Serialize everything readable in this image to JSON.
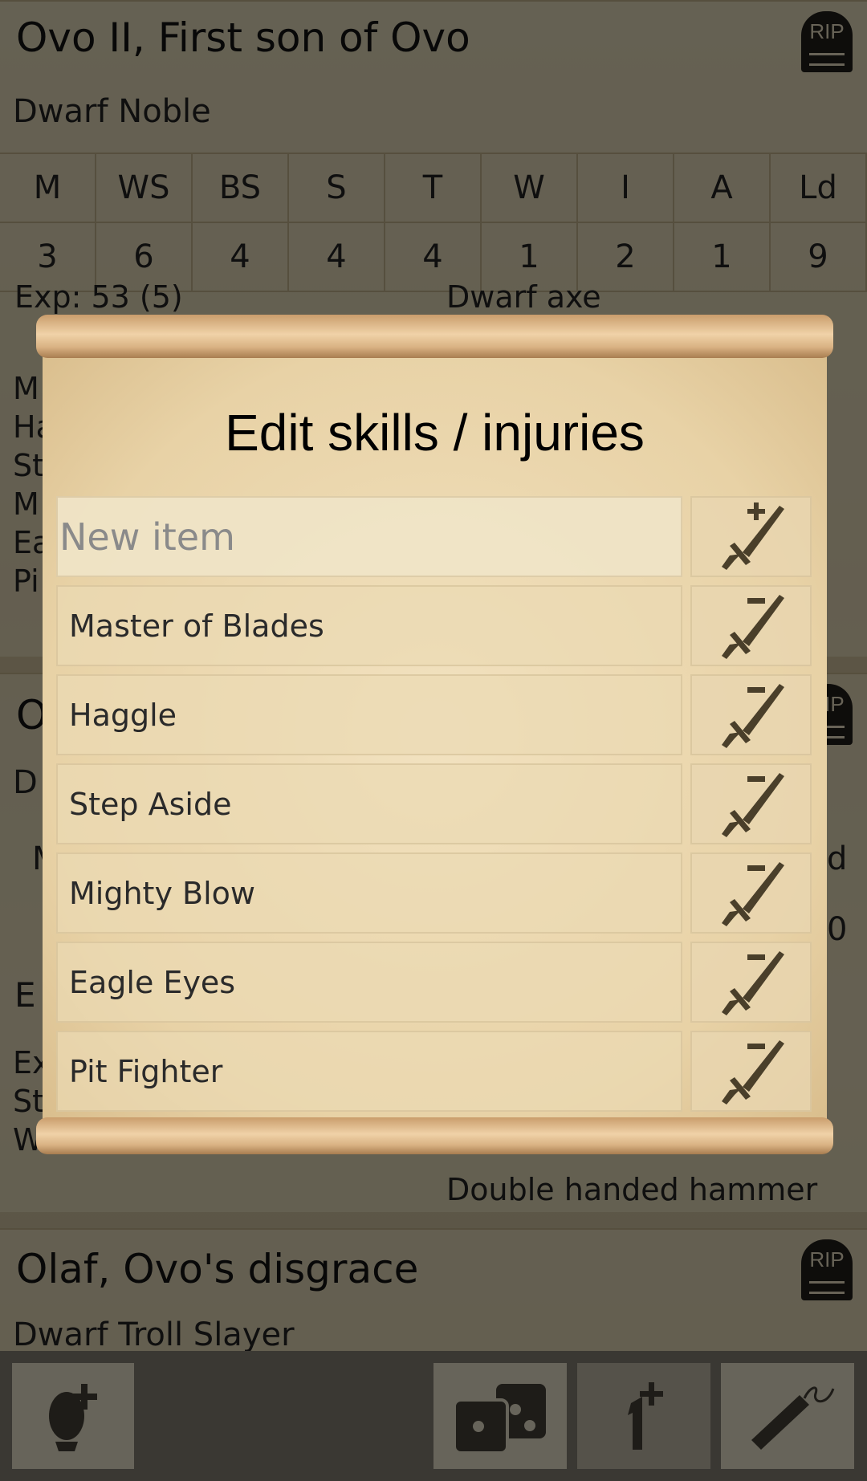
{
  "roster": [
    {
      "name": "Ovo II, First son of Ovo",
      "type": "Dwarf Noble",
      "stat_headers": [
        "M",
        "WS",
        "BS",
        "S",
        "T",
        "W",
        "I",
        "A",
        "Ld"
      ],
      "stat_values": [
        "3",
        "6",
        "4",
        "4",
        "4",
        "1",
        "2",
        "1",
        "9"
      ],
      "exp": "Exp: 53 (5)",
      "skills_partial": [
        "M",
        "Ha",
        "St",
        "M",
        "Ea",
        "Pi"
      ],
      "equipment": [
        "Dwarf axe"
      ]
    },
    {
      "name_partial": "O",
      "type_partial": "D",
      "stat_partial_left": "M",
      "stat_partial_right": "d",
      "value_partial_right": "0",
      "exp_partial": "E",
      "lines_partial": [
        "Ex",
        "St",
        "W"
      ],
      "equipment": [
        "Double handed hammer"
      ]
    },
    {
      "name": "Olaf, Ovo's disgrace",
      "type": "Dwarf Troll Slayer"
    }
  ],
  "rip_label": "RIP",
  "dialog": {
    "title": "Edit skills / injuries",
    "new_item_placeholder": "New item",
    "items": [
      "Master of Blades",
      "Haggle",
      "Step Aside",
      "Mighty Blow",
      "Eagle Eyes",
      "Pit Fighter"
    ]
  },
  "toolbar": {
    "buttons": [
      "add-hero-icon",
      "dice-icon",
      "add-henchman-icon",
      "scroll-quill-icon"
    ]
  }
}
